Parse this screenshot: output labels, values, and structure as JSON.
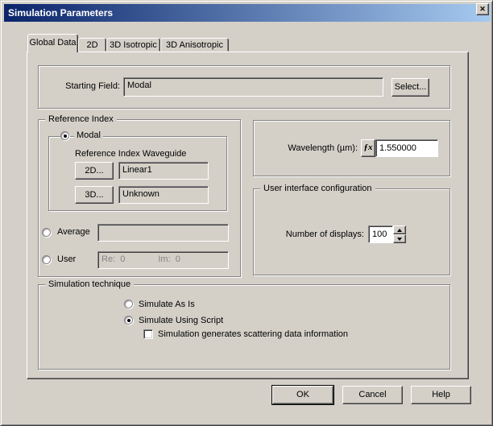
{
  "window": {
    "title": "Simulation Parameters",
    "close_icon": "✕"
  },
  "tabs": {
    "global": "Global Data",
    "two_d": "2D",
    "iso": "3D Isotropic",
    "aniso": "3D Anisotropic",
    "active_tab": "Global Data"
  },
  "starting_field": {
    "label": "Starting Field:",
    "value": "Modal",
    "select_button": "Select..."
  },
  "reference_index": {
    "title": "Reference Index",
    "modal_label": "Modal",
    "modal_selected": true,
    "waveguide_label": "Reference Index Waveguide",
    "button_2d": "2D...",
    "waveguide_2d": "Linear1",
    "button_3d": "3D...",
    "waveguide_3d": "Unknown",
    "average_label": "Average",
    "average_value": "",
    "average_selected": false,
    "user_label": "User",
    "user_selected": false,
    "re_label": "Re:",
    "re_value": "0",
    "im_label": "Im:",
    "im_value": "0"
  },
  "wavelength": {
    "label": "Wavelength (µm):",
    "fx_icon": "ƒx",
    "value": "1.550000"
  },
  "ui_config": {
    "title": "User interface configuration",
    "displays_label": "Number of displays:",
    "displays_value": "100"
  },
  "simulation_technique": {
    "title": "Simulation technique",
    "as_is_label": "Simulate As Is",
    "as_is_selected": false,
    "script_label": "Simulate Using Script",
    "script_selected": true,
    "scattering_label": "Simulation generates scattering data information",
    "scattering_checked": false
  },
  "footer": {
    "ok": "OK",
    "cancel": "Cancel",
    "help": "Help"
  },
  "colors": {
    "titlebar_left": "#0a246a",
    "titlebar_right": "#a6caf0",
    "dialog_face": "#d4d0c8",
    "title_text": "#ffffff"
  }
}
